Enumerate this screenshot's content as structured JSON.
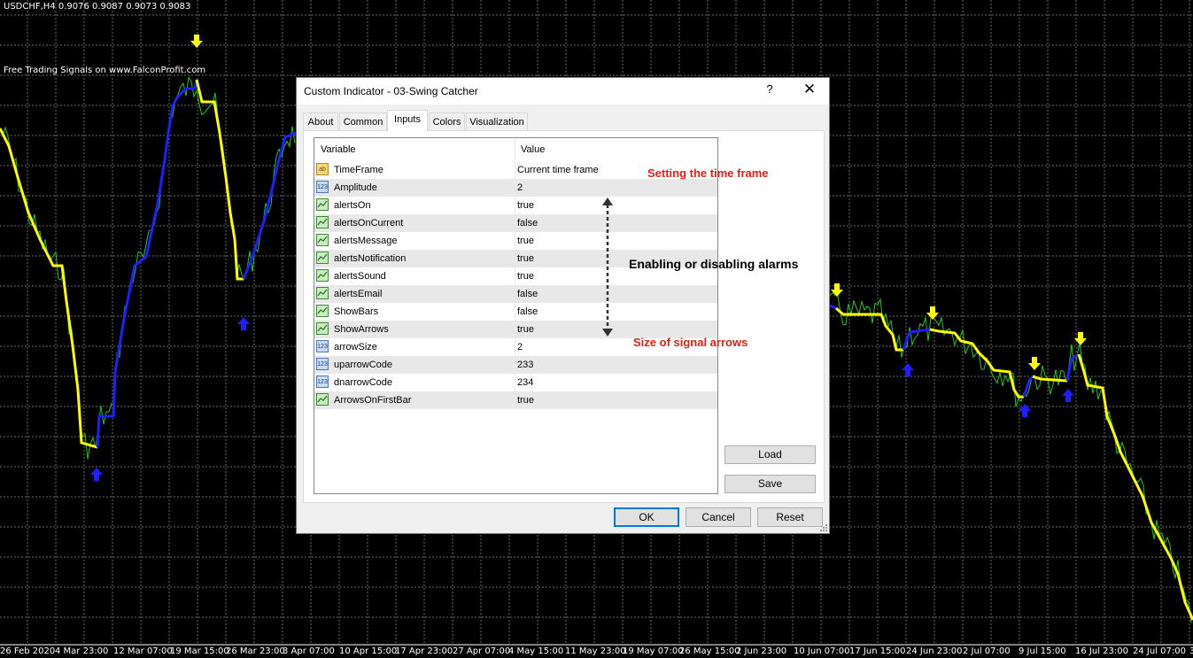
{
  "chart": {
    "title": "USDCHF,H4  0.9076 0.9087 0.9073 0.9083",
    "watermark": "Free Trading Signals on www.FalconProfit.com",
    "x_labels": [
      "26 Feb 2020",
      "4 Mar 23:00",
      "12 Mar 07:00",
      "19 Mar 15:00",
      "26 Mar 23:00",
      "3 Apr 07:00",
      "10 Apr 15:00",
      "17 Apr 23:00",
      "27 Apr 07:00",
      "4 May 15:00",
      "11 May 23:00",
      "19 May 07:00",
      "26 May 15:00",
      "2 Jun 23:00",
      "10 Jun 07:00",
      "17 Jun 15:00",
      "24 Jun 23:00",
      "2 Jul 07:00",
      "9 Jul 15:00",
      "16 Jul 23:00",
      "24 Jul 07:00",
      "3"
    ],
    "colors": {
      "background": "#000000",
      "grid": "#6b6b6b",
      "price": "#22c81e",
      "trend_down": "#ffff00",
      "trend_up": "#1e1eff",
      "arrow_down": "#ffff00",
      "arrow_up": "#1e1eff"
    }
  },
  "dialog": {
    "title": "Custom Indicator - 03-Swing Catcher",
    "help": "?",
    "close": "✕",
    "tabs": [
      "About",
      "Common",
      "Inputs",
      "Colors",
      "Visualization"
    ],
    "active_tab": "Inputs",
    "headers": {
      "variable": "Variable",
      "value": "Value"
    },
    "rows": [
      {
        "type": "ab",
        "name": "TimeFrame",
        "value": "Current time frame"
      },
      {
        "type": "123",
        "name": "Amplitude",
        "value": "2"
      },
      {
        "type": "bool",
        "name": "alertsOn",
        "value": "true"
      },
      {
        "type": "bool",
        "name": "alertsOnCurrent",
        "value": "false"
      },
      {
        "type": "bool",
        "name": "alertsMessage",
        "value": "true"
      },
      {
        "type": "bool",
        "name": "alertsNotification",
        "value": "true"
      },
      {
        "type": "bool",
        "name": "alertsSound",
        "value": "true"
      },
      {
        "type": "bool",
        "name": "alertsEmail",
        "value": "false"
      },
      {
        "type": "bool",
        "name": "ShowBars",
        "value": "false"
      },
      {
        "type": "bool",
        "name": "ShowArrows",
        "value": "true"
      },
      {
        "type": "123",
        "name": "arrowSize",
        "value": "2"
      },
      {
        "type": "123",
        "name": "uparrowCode",
        "value": "233"
      },
      {
        "type": "123",
        "name": "dnarrowCode",
        "value": "234"
      },
      {
        "type": "bool",
        "name": "ArrowsOnFirstBar",
        "value": "true"
      }
    ],
    "buttons": {
      "load": "Load",
      "save": "Save",
      "ok": "OK",
      "cancel": "Cancel",
      "reset": "Reset"
    },
    "annotations": {
      "timeframe": "Setting the time frame",
      "alarms": "Enabling or disabling alarms",
      "arrows": "Size of signal arrows"
    }
  }
}
